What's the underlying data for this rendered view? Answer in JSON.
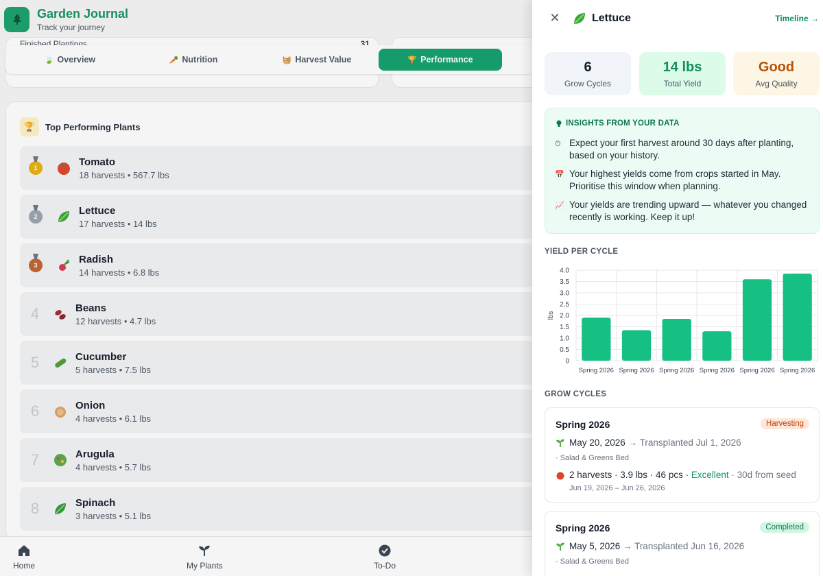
{
  "app": {
    "title": "Garden Journal",
    "subtitle": "Track your journey"
  },
  "stats_peek": {
    "label": "Finished Plantings",
    "value": "31"
  },
  "tabs": [
    {
      "label": "Overview",
      "icon": "leaf-icon"
    },
    {
      "label": "Nutrition",
      "icon": "carrot-icon"
    },
    {
      "label": "Harvest Value",
      "icon": "basket-icon"
    },
    {
      "label": "Performance",
      "icon": "trophy-icon",
      "active": true
    }
  ],
  "performance": {
    "title": "Top Performing Plants",
    "plants": [
      {
        "rank": "1",
        "medal": "gold",
        "name": "Tomato",
        "stats": "18 harvests • 567.7 lbs",
        "icon": "tomato-icon"
      },
      {
        "rank": "2",
        "medal": "silver",
        "name": "Lettuce",
        "stats": "17 harvests • 14 lbs",
        "icon": "lettuce-icon"
      },
      {
        "rank": "3",
        "medal": "bronze",
        "name": "Radish",
        "stats": "14 harvests • 6.8 lbs",
        "icon": "radish-icon"
      },
      {
        "rank": "4",
        "name": "Beans",
        "stats": "12 harvests • 4.7 lbs",
        "icon": "beans-icon"
      },
      {
        "rank": "5",
        "name": "Cucumber",
        "stats": "5 harvests • 7.5 lbs",
        "icon": "cucumber-icon"
      },
      {
        "rank": "6",
        "name": "Onion",
        "stats": "4 harvests • 6.1 lbs",
        "icon": "onion-icon"
      },
      {
        "rank": "7",
        "name": "Arugula",
        "stats": "4 harvests • 5.7 lbs",
        "icon": "arugula-icon"
      },
      {
        "rank": "8",
        "name": "Spinach",
        "stats": "3 harvests • 5.1 lbs",
        "icon": "spinach-icon"
      }
    ]
  },
  "bottom_nav": [
    {
      "label": "Home",
      "icon": "home-icon"
    },
    {
      "label": "My Plants",
      "icon": "sprout-icon"
    },
    {
      "label": "To-Do",
      "icon": "check-circle-icon"
    }
  ],
  "drawer": {
    "title": "Lettuce",
    "timeline_link": "Timeline →",
    "kpis": [
      {
        "value": "6",
        "label": "Grow Cycles",
        "color": "#111827",
        "bg": "#f1f5f9"
      },
      {
        "value": "14 lbs",
        "label": "Total Yield",
        "color": "#0f8f5c",
        "bg": "#dcfce9"
      },
      {
        "value": "Good",
        "label": "Avg Quality",
        "color": "#b45309",
        "bg": "#fef6e4"
      }
    ],
    "insights": {
      "title": "INSIGHTS FROM YOUR DATA",
      "items": [
        {
          "icon": "stopwatch-icon",
          "text": "Expect your first harvest around 30 days after planting, based on your history."
        },
        {
          "icon": "calendar-icon",
          "text": "Your highest yields come from crops started in May. Prioritise this window when planning."
        },
        {
          "icon": "trend-up-icon",
          "text": "Your yields are trending upward — whatever you changed recently is working. Keep it up!"
        }
      ]
    },
    "yield_label": "YIELD PER CYCLE",
    "cycles_label": "GROW CYCLES",
    "cycles": [
      {
        "season": "Spring 2026",
        "status": "Harvesting",
        "started": "May 20, 2026",
        "transplanted": "→ Transplanted Jul 1, 2026",
        "bed": "· Salad & Greens Bed",
        "harvest_summary": "2 harvests · 3.9 lbs · 46 pcs ·",
        "quality": "Excellent",
        "days": "· 30d from seed",
        "range": "Jun 19, 2026 – Jun 26, 2026"
      },
      {
        "season": "Spring 2026",
        "status": "Completed",
        "started": "May 5, 2026",
        "transplanted": "→ Transplanted Jun 16, 2026",
        "bed": "· Salad & Greens Bed"
      }
    ]
  },
  "chart_data": {
    "type": "bar",
    "categories": [
      "Spring 2026",
      "Spring 2026",
      "Spring 2026",
      "Spring 2026",
      "Spring 2026",
      "Spring 2026"
    ],
    "values": [
      1.9,
      1.35,
      1.85,
      1.3,
      3.6,
      3.85
    ],
    "ylabel": "lbs",
    "ylim": [
      0,
      4.0
    ],
    "yticks": [
      "0",
      "0.5",
      "1.0",
      "1.5",
      "2.0",
      "2.5",
      "3.0",
      "3.5",
      "4.0"
    ],
    "color": "#16c083",
    "grid": true
  }
}
